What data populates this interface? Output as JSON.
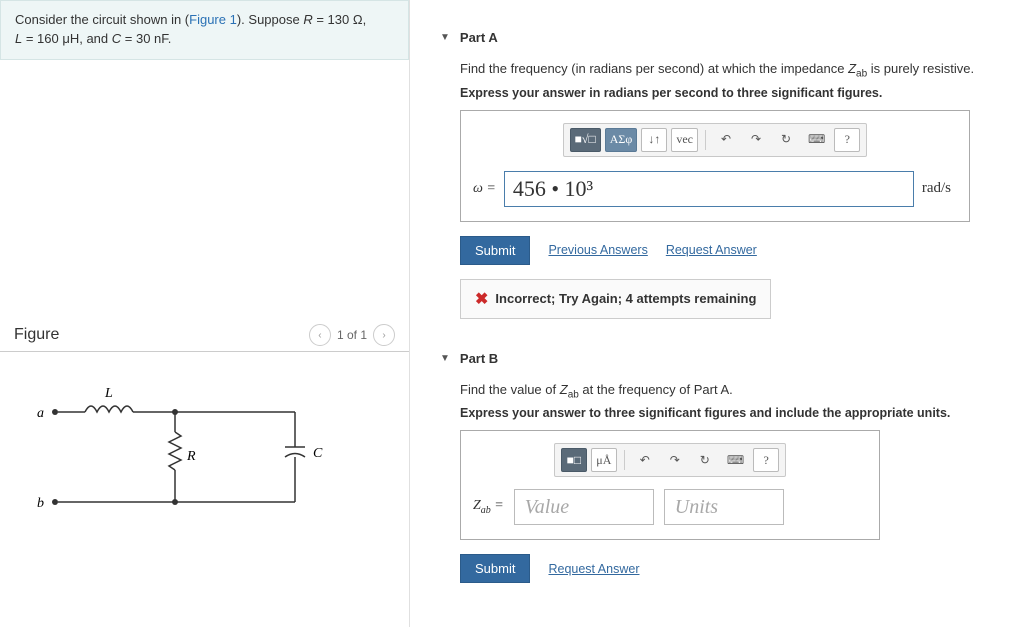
{
  "problem": {
    "prefix": "Consider the circuit shown in (",
    "figure_link": "Figure 1",
    "suffix1": "). Suppose ",
    "eq1a": "R",
    "eq1b": " = 130 Ω, ",
    "eq2a": "L",
    "eq2b": " = 160 μH, and ",
    "eq3a": "C",
    "eq3b": " = 30 nF."
  },
  "figure": {
    "title": "Figure",
    "pager": "1 of 1",
    "labels": {
      "a": "a",
      "b": "b",
      "L": "L",
      "R": "R",
      "C": "C"
    }
  },
  "partA": {
    "title": "Part A",
    "prompt_pre": "Find the frequency (in radians per second) at which the impedance ",
    "prompt_var": "Z",
    "prompt_sub": "ab",
    "prompt_post": " is purely resistive.",
    "instruction": "Express your answer in radians per second to three significant figures.",
    "toolbar": {
      "templates": "■√□",
      "greek": "ΑΣφ",
      "sort": "↓↑",
      "vec": "vec",
      "undo": "↶",
      "redo": "↷",
      "reset": "↻",
      "keyboard": "⌨",
      "help": "?"
    },
    "var_label": "ω = ",
    "input_value": "456 • 10³",
    "unit_label": "rad/s",
    "submit": "Submit",
    "prev_answers": "Previous Answers",
    "req_answer": "Request Answer",
    "feedback": "Incorrect; Try Again; 4 attempts remaining"
  },
  "partB": {
    "title": "Part B",
    "prompt_pre": "Find the value of ",
    "prompt_var": "Z",
    "prompt_sub": "ab",
    "prompt_post": " at the frequency of Part A.",
    "instruction": "Express your answer to three significant figures and include the appropriate units.",
    "toolbar": {
      "templates": "■□",
      "units": "μÅ",
      "undo": "↶",
      "redo": "↷",
      "reset": "↻",
      "keyboard": "⌨",
      "help": "?"
    },
    "var_label_v": "Z",
    "var_label_sub": "ab",
    "var_label_eq": " = ",
    "value_ph": "Value",
    "units_ph": "Units",
    "submit": "Submit",
    "req_answer": "Request Answer"
  }
}
